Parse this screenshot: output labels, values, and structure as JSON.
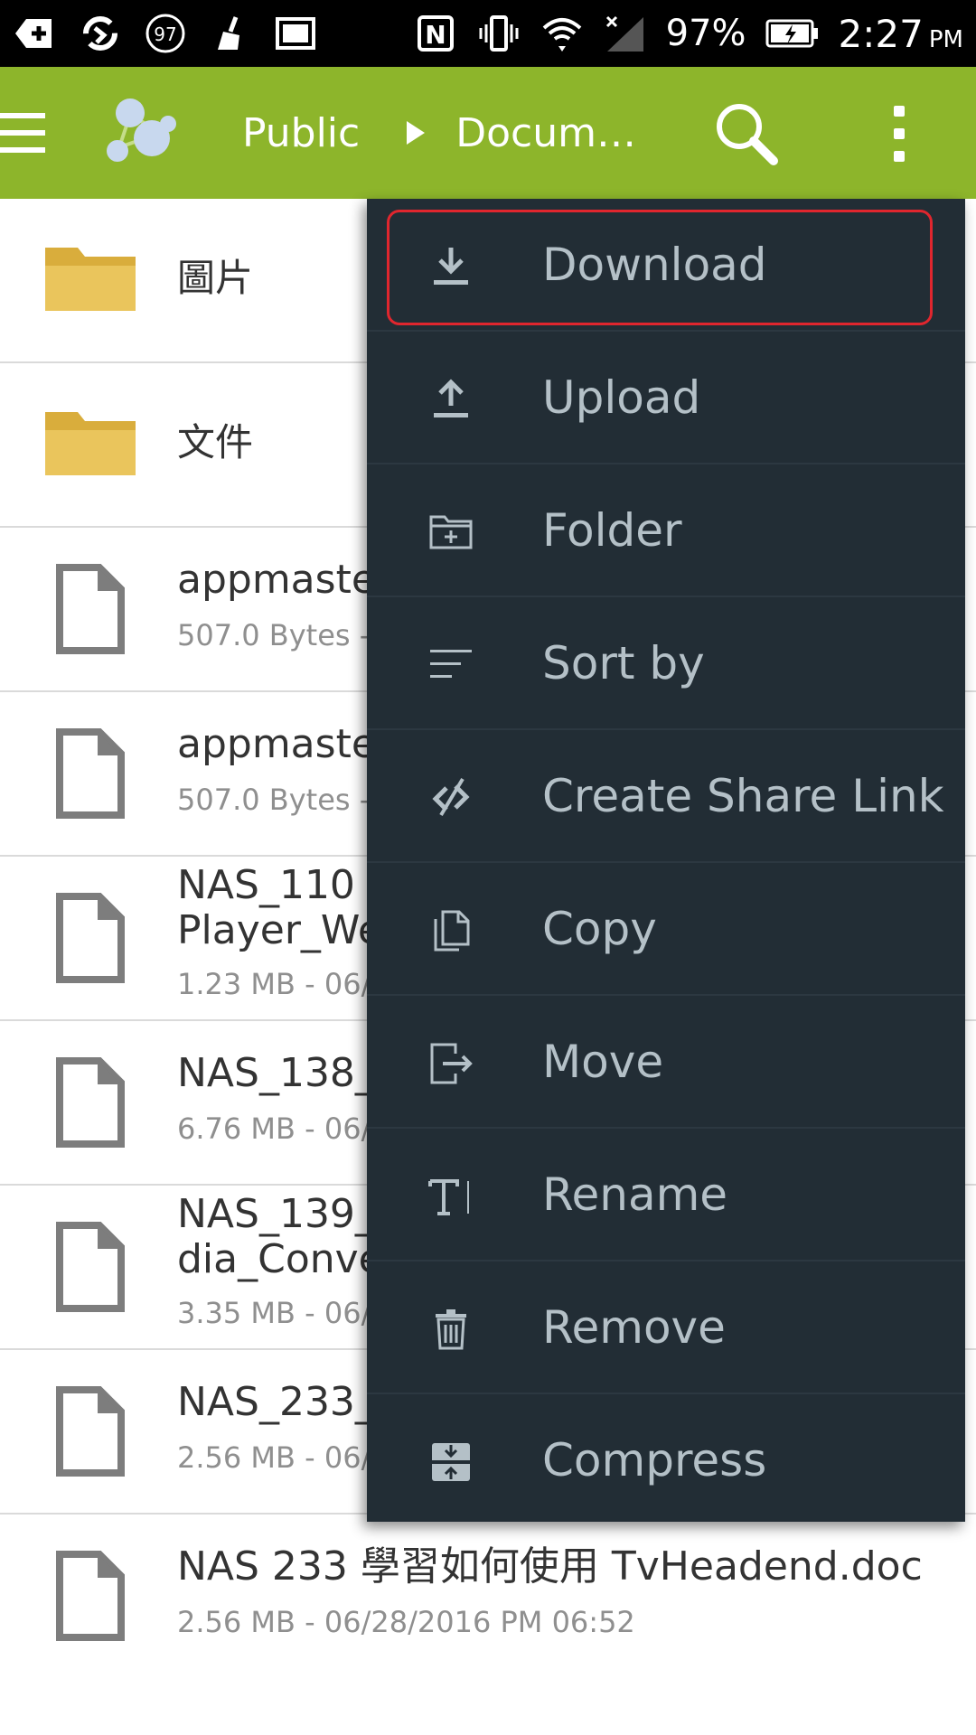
{
  "status_bar": {
    "notification_badge": "97",
    "battery_percent": "97%",
    "time": "2:27",
    "ampm": "PM"
  },
  "app_bar": {
    "breadcrumb_root": "Public",
    "breadcrumb_current": "Docum…",
    "accent_color": "#8db52b"
  },
  "files": [
    {
      "type": "folder",
      "name": "圖片",
      "meta": ""
    },
    {
      "type": "folder",
      "name": "文件",
      "meta": ""
    },
    {
      "type": "file",
      "name": "appmaster",
      "meta": "507.0 Bytes -"
    },
    {
      "type": "file",
      "name": "appmaster",
      "meta": "507.0 Bytes -"
    },
    {
      "type": "file",
      "name": "NAS_110 I",
      "name2": "Player_We",
      "meta": "1.23 MB - 06/"
    },
    {
      "type": "file",
      "name": "NAS_138_",
      "meta": "6.76 MB - 06/"
    },
    {
      "type": "file",
      "name": "NAS_139_",
      "name2": "dia_Conve",
      "meta": "3.35 MB - 06/"
    },
    {
      "type": "file",
      "name": "NAS_233_",
      "meta": "2.56 MB - 06/"
    },
    {
      "type": "file",
      "name": "NAS 233 學習如何使用 TvHeadend.doc",
      "meta": "2.56 MB - 06/28/2016 PM 06:52"
    }
  ],
  "menu": {
    "items": [
      {
        "label": "Download",
        "icon": "download-icon"
      },
      {
        "label": "Upload",
        "icon": "upload-icon"
      },
      {
        "label": "Folder",
        "icon": "new-folder-icon"
      },
      {
        "label": "Sort by",
        "icon": "sort-icon"
      },
      {
        "label": "Create Share Link",
        "icon": "share-link-icon"
      },
      {
        "label": "Copy",
        "icon": "copy-icon"
      },
      {
        "label": "Move",
        "icon": "move-icon"
      },
      {
        "label": "Rename",
        "icon": "rename-icon"
      },
      {
        "label": "Remove",
        "icon": "trash-icon"
      },
      {
        "label": "Compress",
        "icon": "compress-icon"
      }
    ],
    "highlighted": "Download",
    "highlight_color": "#e0262e"
  }
}
